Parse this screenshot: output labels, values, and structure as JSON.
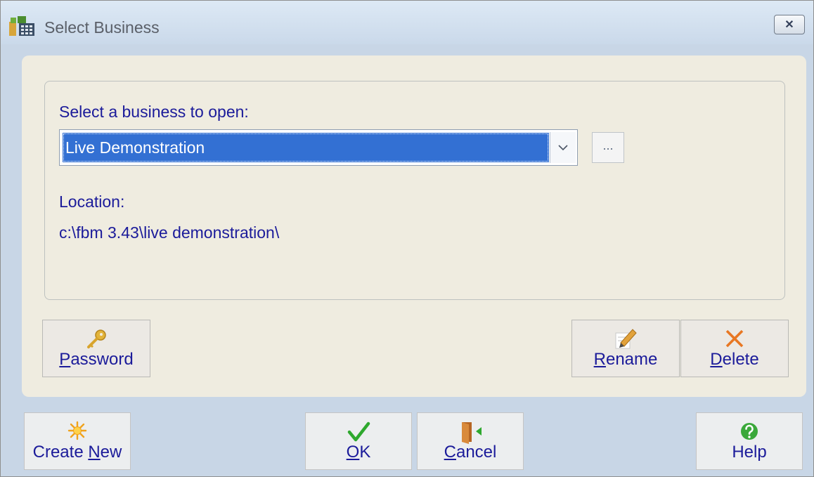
{
  "window": {
    "title": "Select Business",
    "close_glyph": "✕"
  },
  "group": {
    "prompt": "Select a business to open:",
    "selected_business": "Live Demonstration",
    "browse_label": "...",
    "location_label": "Location:",
    "location_value": "c:\\fbm 3.43\\live demonstration\\"
  },
  "panel_buttons": {
    "password": {
      "pre": "",
      "key": "P",
      "post": "assword"
    },
    "rename": {
      "pre": "",
      "key": "R",
      "post": "ename"
    },
    "delete": {
      "pre": "",
      "key": "D",
      "post": "elete"
    }
  },
  "footer_buttons": {
    "create_new": {
      "pre": "Create ",
      "key": "N",
      "post": "ew"
    },
    "ok": {
      "pre": "",
      "key": "O",
      "post": "K"
    },
    "cancel": {
      "pre": "",
      "key": "C",
      "post": "ancel"
    },
    "help": {
      "pre": "Help",
      "key": "",
      "post": ""
    }
  },
  "icons": {
    "app": "business-app-icon",
    "password": "key-icon",
    "rename": "pencil-icon",
    "delete": "x-mark-icon",
    "create_new": "sparkle-icon",
    "ok": "checkmark-icon",
    "cancel": "exit-door-icon",
    "help": "help-circle-icon"
  },
  "colors": {
    "label_text": "#1b1b9a",
    "selection": "#3370d3",
    "panel": "#efece0",
    "delete_x": "#e87722",
    "ok_check": "#2ea82e",
    "help_circle": "#3aa83a"
  }
}
